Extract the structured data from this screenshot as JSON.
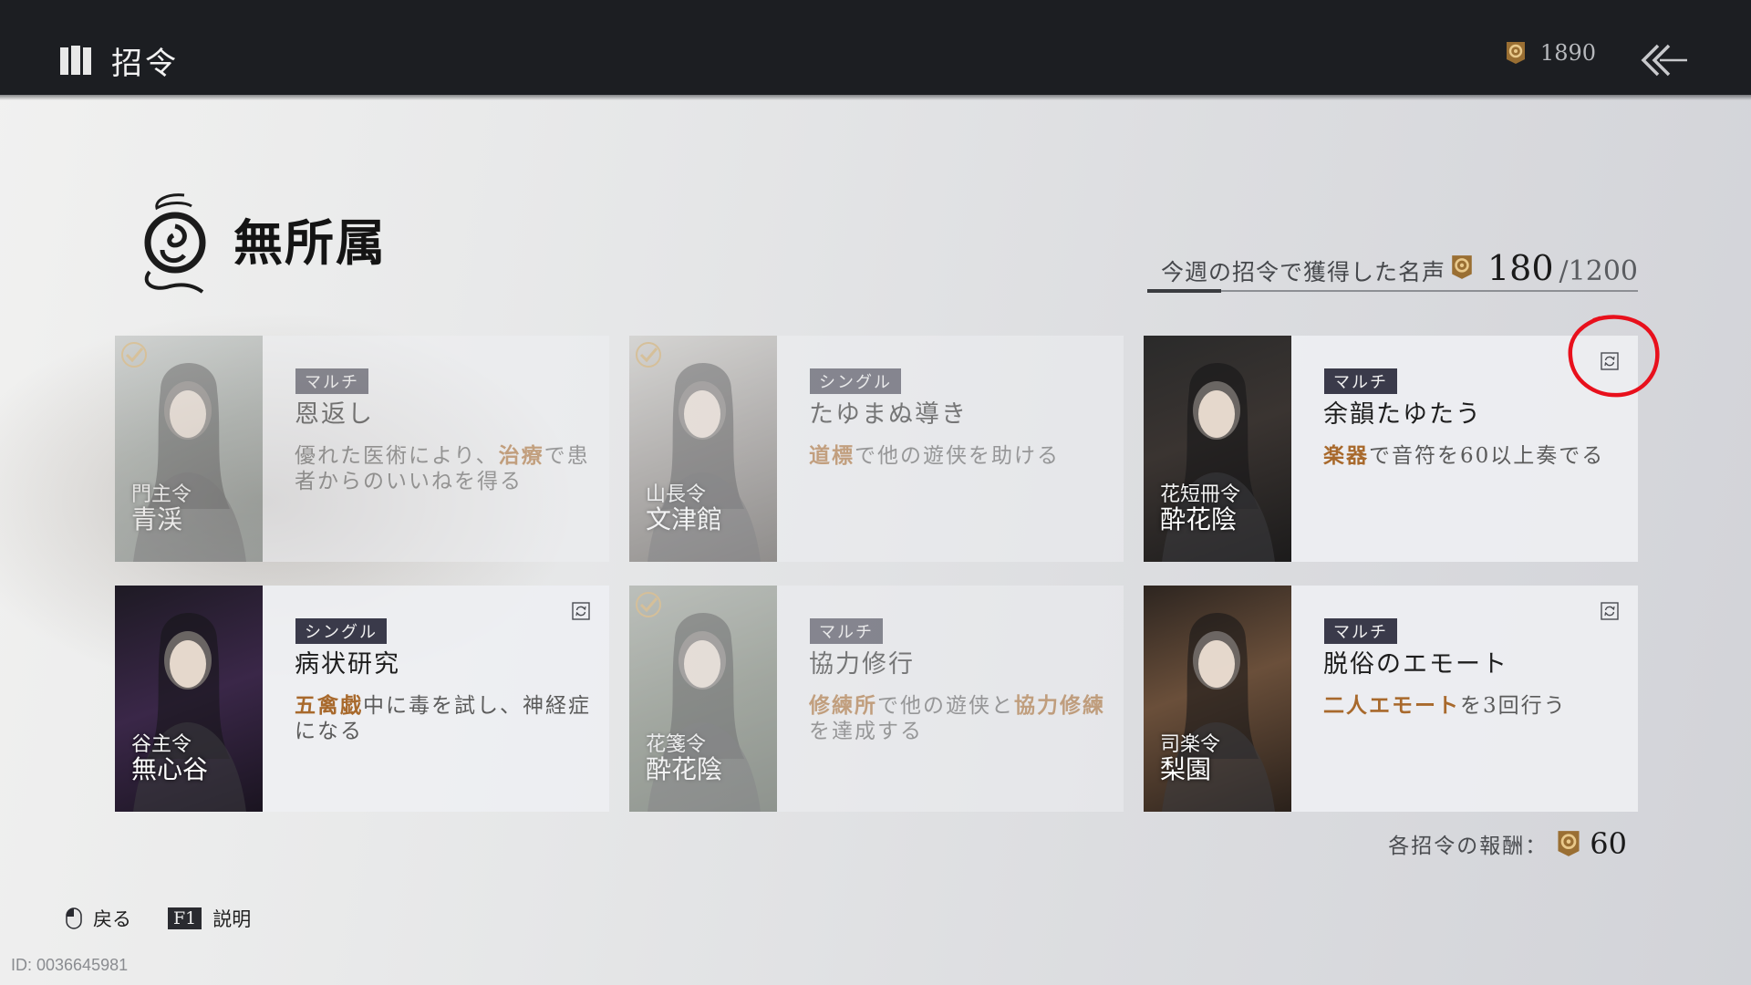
{
  "header": {
    "title": "招令",
    "currency_value": "1890"
  },
  "faction": {
    "name": "無所属"
  },
  "weekly": {
    "label": "今週の招令で獲得した名声",
    "current": "180",
    "max": "/1200",
    "progress_fraction": 0.15
  },
  "cards": [
    {
      "badge": "マルチ",
      "title": "恩返し",
      "desc_parts": [
        {
          "text": "優れた医術により、",
          "hl": false
        },
        {
          "text": "治療",
          "hl": true
        },
        {
          "text": "で患者からのいいねを得る",
          "hl": false
        }
      ],
      "guild": "門主令",
      "leader": "青渓",
      "completed": true,
      "refreshable": false
    },
    {
      "badge": "シングル",
      "title": "たゆまぬ導き",
      "desc_parts": [
        {
          "text": "道標",
          "hl": true
        },
        {
          "text": "で他の遊侠を助ける",
          "hl": false
        }
      ],
      "guild": "山長令",
      "leader": "文津館",
      "completed": true,
      "refreshable": false
    },
    {
      "badge": "マルチ",
      "title": "余韻たゆたう",
      "desc_parts": [
        {
          "text": "楽器",
          "hl": true
        },
        {
          "text": "で音符を60以上奏でる",
          "hl": false
        }
      ],
      "guild": "花短冊令",
      "leader": "酔花陰",
      "completed": false,
      "refreshable": true
    },
    {
      "badge": "シングル",
      "title": "病状研究",
      "desc_parts": [
        {
          "text": "五禽戯",
          "hl": true
        },
        {
          "text": "中に毒を試し、神経症になる",
          "hl": false
        }
      ],
      "guild": "谷主令",
      "leader": "無心谷",
      "completed": false,
      "refreshable": true
    },
    {
      "badge": "マルチ",
      "title": "協力修行",
      "desc_parts": [
        {
          "text": "修練所",
          "hl": true
        },
        {
          "text": "で他の遊侠と",
          "hl": false
        },
        {
          "text": "協力修練",
          "hl": true
        },
        {
          "text": "を達成する",
          "hl": false
        }
      ],
      "guild": "花箋令",
      "leader": "酔花陰",
      "completed": true,
      "refreshable": false
    },
    {
      "badge": "マルチ",
      "title": "脱俗のエモート",
      "desc_parts": [
        {
          "text": "二人エモート",
          "hl": true
        },
        {
          "text": "を3回行う",
          "hl": false
        }
      ],
      "guild": "司楽令",
      "leader": "梨園",
      "completed": false,
      "refreshable": true
    }
  ],
  "reward": {
    "label": "各招令の報酬：",
    "value": "60"
  },
  "footer": {
    "back_label": "戻る",
    "help_key": "F1",
    "help_label": "説明",
    "user_id": "ID: 0036645981"
  },
  "colors": {
    "highlight": "#a8692c",
    "badge_bg": "#3a3a4a",
    "annotation": "#e8101c"
  },
  "icons": {
    "app": "book-icon",
    "currency": "fame-token-icon",
    "back": "double-chevron-back-icon",
    "refresh": "refresh-icon",
    "check": "checkmark-icon",
    "mouse": "mouse-icon"
  }
}
